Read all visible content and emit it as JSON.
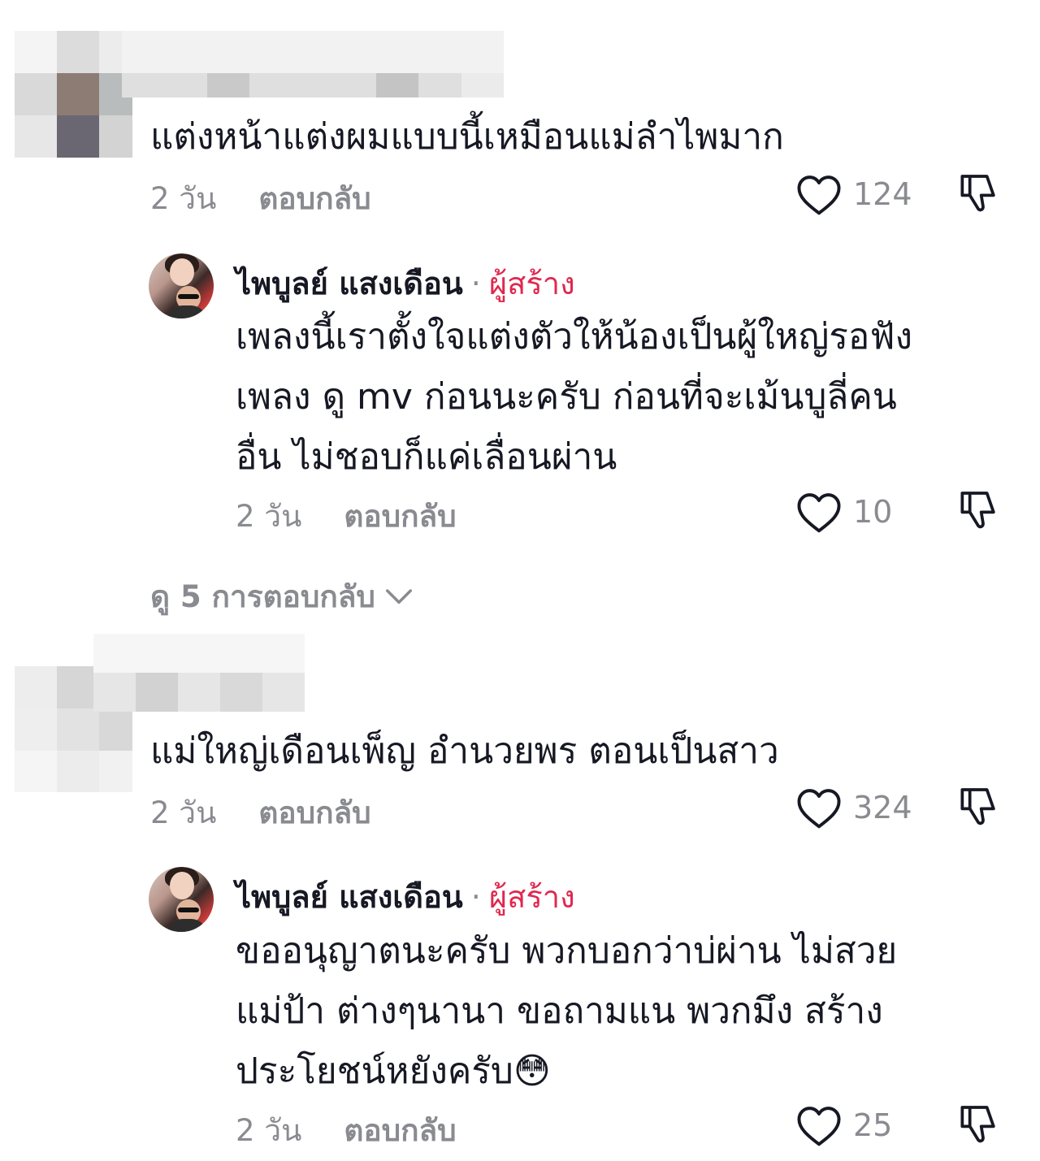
{
  "comments": [
    {
      "text": "แต่งหน้าแต่งผมแบบนี้เหมือนแม่ลำไพมาก",
      "time": "2 วัน",
      "reply_label": "ตอบกลับ",
      "likes": "124",
      "reply": {
        "author": "ไพบูลย์ แสงเดือน",
        "separator": "·",
        "badge": "ผู้สร้าง",
        "lines": [
          "เพลงนี้เราตั้งใจแต่งตัวให้น้องเป็นผู้ใหญ่รอฟัง",
          "เพลง ดู mv ก่อนนะครับ ก่อนที่จะเม้นบูลี่คน",
          "อื่น ไม่ชอบก็แค่เลื่อนผ่าน"
        ],
        "time": "2 วัน",
        "reply_label": "ตอบกลับ",
        "likes": "10"
      },
      "view_replies": "ดู 5 การตอบกลับ"
    },
    {
      "text": "แม่ใหญ่เดือนเพ็ญ อำนวยพร ตอนเป็นสาว",
      "time": "2 วัน",
      "reply_label": "ตอบกลับ",
      "likes": "324",
      "reply": {
        "author": "ไพบูลย์ แสงเดือน",
        "separator": "·",
        "badge": "ผู้สร้าง",
        "lines": [
          "ขออนุญาตนะครับ พวกบอกว่าบ่ผ่าน ไม่สวย",
          "แม่ป้า ต่างๆนานา ขอถามแน พวกมึง สร้าง",
          "ประโยชน์หยังครับ😳"
        ],
        "time": "2 วัน",
        "reply_label": "ตอบกลับ",
        "likes": "25"
      }
    }
  ],
  "colors": {
    "text": "#161823",
    "muted": "#8a8b91",
    "creator_badge": "#e0284f"
  }
}
